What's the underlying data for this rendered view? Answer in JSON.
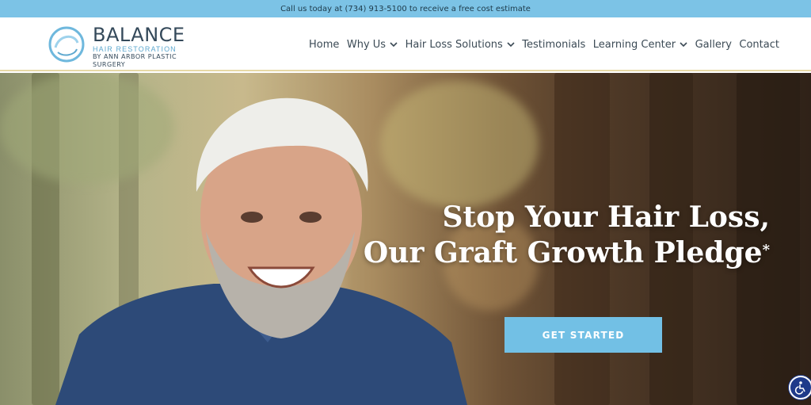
{
  "topbar": {
    "text": "Call us today at (734) 913-5100 to receive a free cost estimate"
  },
  "logo": {
    "title": "BALANCE",
    "subtitle": "HAIR RESTORATION",
    "byline": "BY ANN ARBOR PLASTIC SURGERY"
  },
  "nav": {
    "items": [
      {
        "label": "Home",
        "has_dropdown": false
      },
      {
        "label": "Why Us",
        "has_dropdown": true
      },
      {
        "label": "Hair Loss Solutions",
        "has_dropdown": true
      },
      {
        "label": "Testimonials",
        "has_dropdown": false
      },
      {
        "label": "Learning Center",
        "has_dropdown": true
      },
      {
        "label": "Gallery",
        "has_dropdown": false
      },
      {
        "label": "Contact",
        "has_dropdown": false
      }
    ]
  },
  "hero": {
    "title_line1": "Stop Your Hair Loss,",
    "title_line2": "Our Graft Growth Pledge",
    "asterisk": "*",
    "cta_label": "GET STARTED"
  },
  "icons": {
    "logo_mark": "circle-swirl-icon",
    "dropdown": "chevron-down-icon",
    "accessibility": "wheelchair-icon"
  },
  "colors": {
    "topbar": "#7cc3e6",
    "cta": "#72c0e5",
    "nav_text": "#3b4a55",
    "accessibility_badge": "#1e3a8a"
  }
}
